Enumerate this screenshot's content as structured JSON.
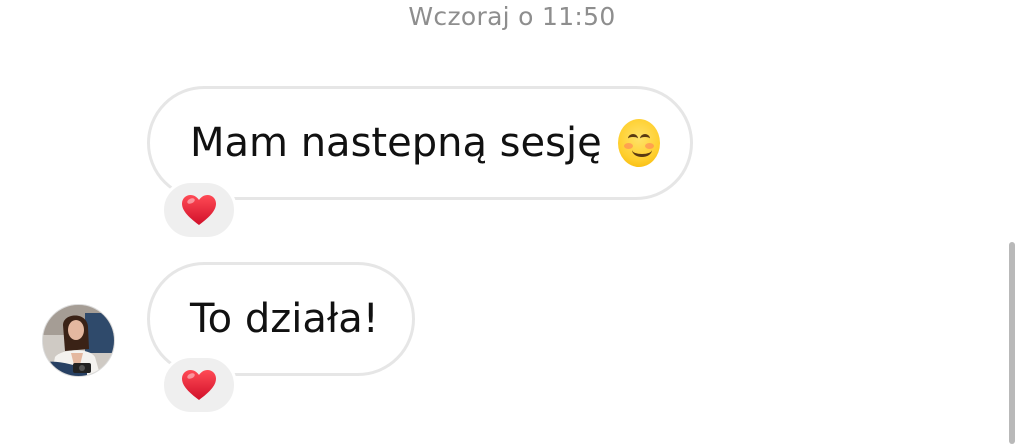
{
  "conversation": {
    "timestamp": "Wczoraj o 11:50",
    "messages": [
      {
        "text": "Mam nastepną sesję",
        "trailing_emoji": "smiling-face-with-smiling-eyes",
        "reaction": "red-heart"
      },
      {
        "text": "To działa!",
        "reaction": "red-heart"
      }
    ]
  },
  "colors": {
    "bubble_border": "#e6e6e6",
    "reaction_bg": "#efefef",
    "timestamp": "#8e8e8e",
    "heart": "#e0192d",
    "text": "#111111"
  }
}
